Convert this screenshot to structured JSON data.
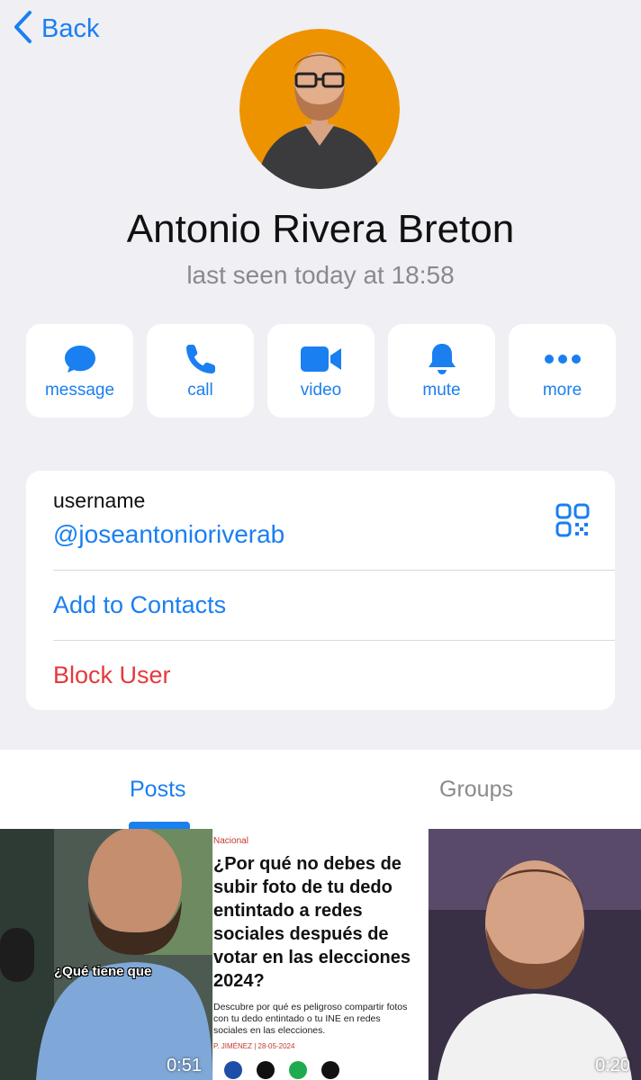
{
  "nav": {
    "back_label": "Back"
  },
  "profile": {
    "name": "Antonio Rivera Breton",
    "last_seen": "last seen today at 18:58"
  },
  "actions": [
    {
      "label": "message",
      "icon": "message-bubble-icon"
    },
    {
      "label": "call",
      "icon": "phone-icon"
    },
    {
      "label": "video",
      "icon": "video-camera-icon"
    },
    {
      "label": "mute",
      "icon": "bell-icon"
    },
    {
      "label": "more",
      "icon": "ellipsis-icon"
    }
  ],
  "info": {
    "username_label": "username",
    "username": "@joseantonioriverab",
    "add_contacts": "Add to Contacts",
    "block_user": "Block User"
  },
  "tabs": [
    {
      "label": "Posts",
      "active": true
    },
    {
      "label": "Groups",
      "active": false
    }
  ],
  "media": [
    {
      "type": "video",
      "duration": "0:51",
      "subtitle": "¿Qué tiene que"
    },
    {
      "type": "article",
      "tag": "Nacional",
      "headline": "¿Por qué no debes de subir foto de tu dedo entintado a redes sociales después de votar en las elecciones 2024?",
      "summary": "Descubre por qué es peligroso compartir fotos con tu dedo entintado o tu INE en redes sociales en las elecciones.",
      "byline": "P. JIMÉNEZ | 28-05-2024"
    },
    {
      "type": "video",
      "duration": "0:20"
    }
  ],
  "colors": {
    "accent": "#1a7ff0",
    "destructive": "#e5393b",
    "background": "#efeff4",
    "avatar_bg": "#ee9300"
  }
}
